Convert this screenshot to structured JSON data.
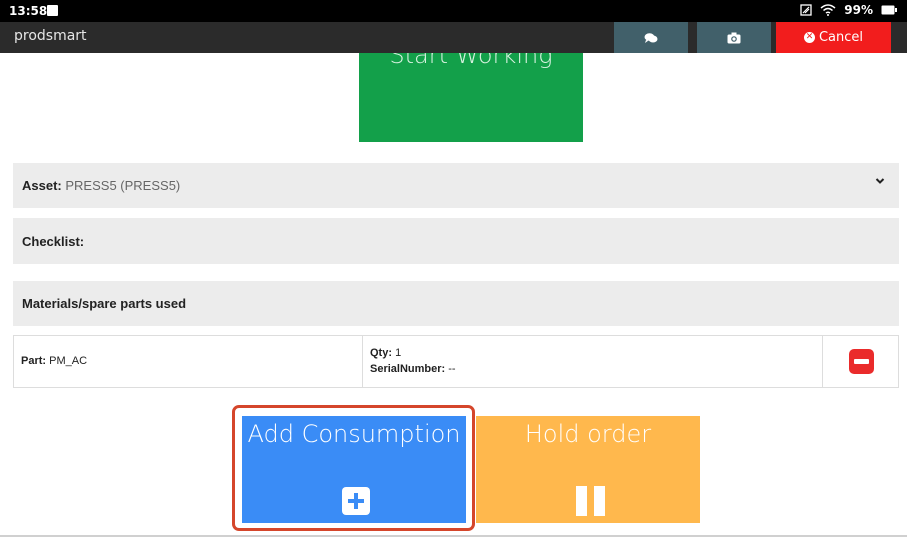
{
  "status_bar": {
    "time": "13:58",
    "battery": "99%"
  },
  "app_bar": {
    "brand": "prodsmart",
    "cancel_label": "Cancel",
    "icons": [
      "chat-icon",
      "camera-icon"
    ]
  },
  "start_tile": {
    "label": "Start Working"
  },
  "asset": {
    "label": "Asset:",
    "value": "PRESS5 (PRESS5)"
  },
  "checklist": {
    "label": "Checklist:"
  },
  "materials": {
    "label": "Materials/spare parts used"
  },
  "part_row": {
    "part_label": "Part:",
    "part_value": "PM_AC",
    "qty_label": "Qty:",
    "qty_value": "1",
    "serial_label": "SerialNumber:",
    "serial_value": "--"
  },
  "tiles": {
    "add_label": "Add Consumption",
    "hold_label": "Hold order"
  },
  "colors": {
    "green": "#13a04a",
    "blue": "#3a8cf6",
    "orange": "#ffb84d",
    "red": "#f21d1d",
    "teal": "#41606a"
  }
}
